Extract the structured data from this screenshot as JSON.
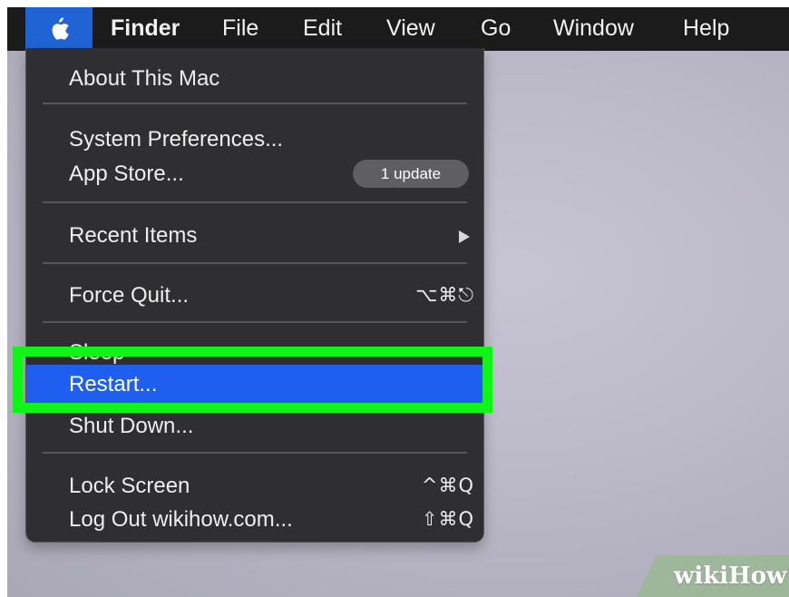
{
  "menubar": {
    "apple_icon": "apple-logo-icon",
    "items": [
      "Finder",
      "File",
      "Edit",
      "View",
      "Go",
      "Window",
      "Help"
    ]
  },
  "apple_menu": {
    "items": [
      {
        "label": "About This Mac"
      },
      {
        "label": "System Preferences..."
      },
      {
        "label": "App Store...",
        "badge": "1 update"
      },
      {
        "label": "Recent Items",
        "submenu_icon": "chevron-right-icon"
      },
      {
        "label": "Force Quit...",
        "shortcut": "⌥⌘⎋"
      },
      {
        "label": "Sleep"
      },
      {
        "label": "Restart...",
        "selected": true
      },
      {
        "label": "Shut Down..."
      },
      {
        "label": "Lock Screen",
        "shortcut": "^⌘Q"
      },
      {
        "label": "Log Out wikihow.com...",
        "shortcut": "⇧⌘Q"
      }
    ]
  },
  "annotation": {
    "highlight_color": "#10f517"
  },
  "watermark": {
    "text": "wikiHow"
  },
  "colors": {
    "menubar": "#1b1b1c",
    "menu_background": "#2f2f31",
    "selection": "#1f5ff0",
    "apple_selection": "#1f63d5"
  }
}
